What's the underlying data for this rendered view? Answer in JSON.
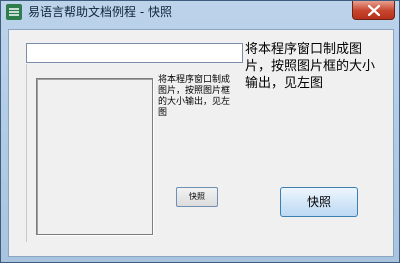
{
  "window": {
    "title": "易语言帮助文档例程 - 快照"
  },
  "preview": {
    "label": "将本程序窗口制成图片，按照图片框的大小输出，见左图",
    "button_label": "快照"
  },
  "main": {
    "label": "将本程序窗口制成图片，按照图片框的大小输出，见左图",
    "button_label": "快照"
  },
  "colors": {
    "close_button": "#c6432c",
    "app_icon": "#2e7d4f"
  },
  "icons": {
    "app": "app-icon",
    "close": "close-icon"
  }
}
